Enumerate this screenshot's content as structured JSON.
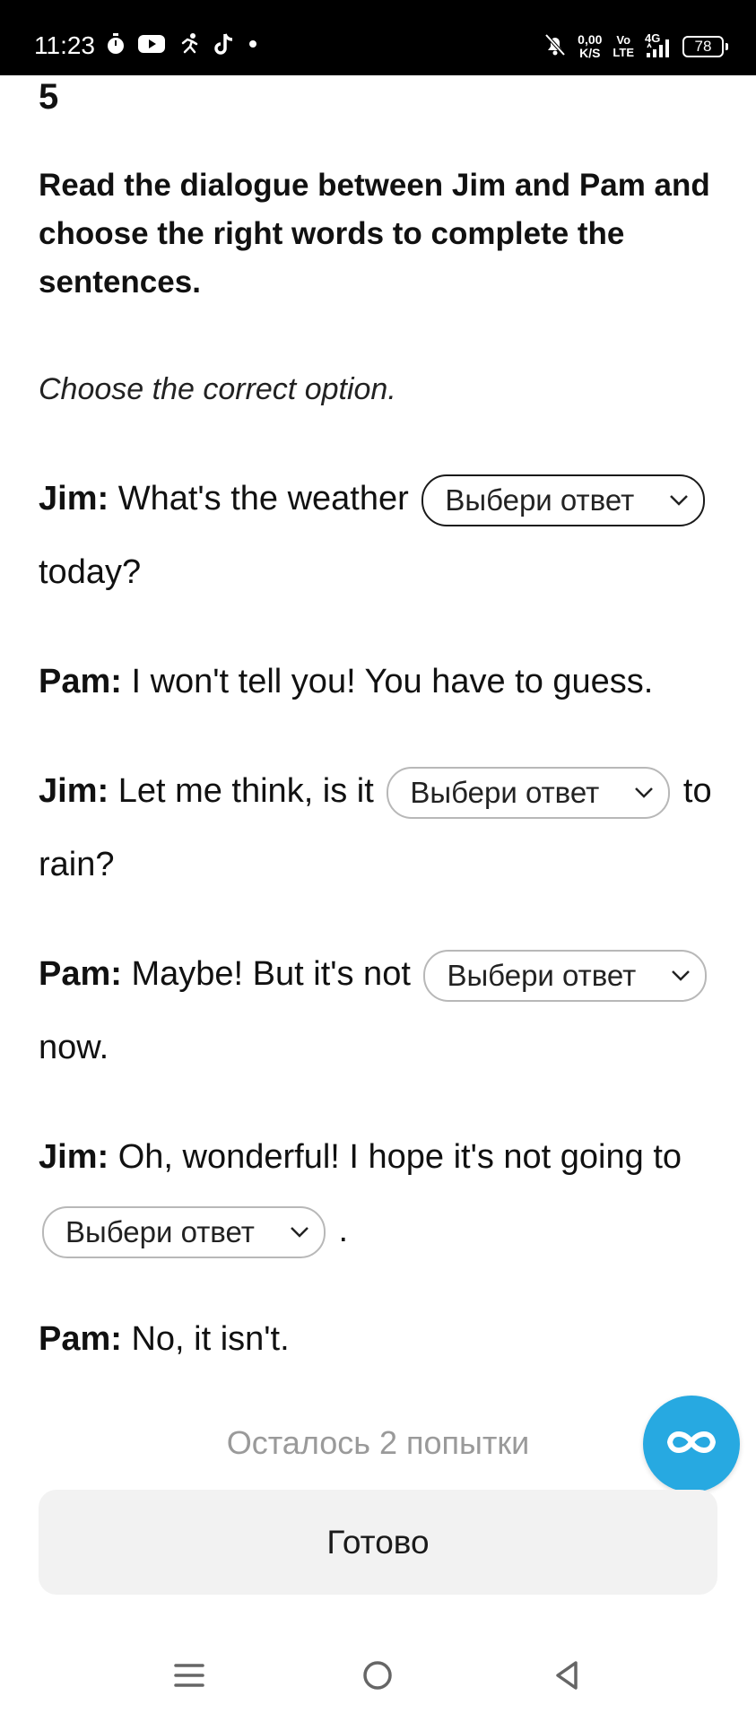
{
  "status_bar": {
    "time": "11:23",
    "net_speed_value": "0,00",
    "net_speed_unit": "K/S",
    "volte_top": "Vo",
    "volte_bottom": "LTE",
    "network": "4G",
    "battery": "78"
  },
  "question": {
    "number": "5",
    "instruction": "Read the dialogue between Jim and Pam and choose the right words to complete the sentences.",
    "subinstruction": "Choose the correct option."
  },
  "dialogue": {
    "line1": {
      "speaker": "Jim:",
      "before": " What's the weather ",
      "after": " today?"
    },
    "line2": {
      "speaker": "Pam:",
      "text": " I won't tell you! You have to guess."
    },
    "line3": {
      "speaker": "Jim:",
      "before": " Let me think, is it ",
      "after": " to rain?"
    },
    "line4": {
      "speaker": "Pam:",
      "before": " Maybe! But it's not ",
      "after": " now."
    },
    "line5": {
      "speaker": "Jim:",
      "before": " Oh, wonderful! I hope it's not going to ",
      "after": " ."
    },
    "line6": {
      "speaker": "Pam:",
      "text": " No, it isn't."
    }
  },
  "select_placeholder": "Выбери ответ",
  "attempts_text": "Осталось 2 попытки",
  "done_label": "Готово",
  "colors": {
    "fab": "#27a9e1",
    "done_bg": "#f2f2f2",
    "attempts_text": "#9a9a9a"
  }
}
